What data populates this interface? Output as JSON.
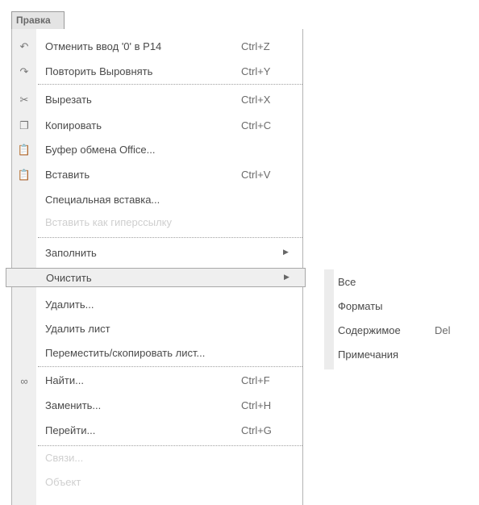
{
  "menu": {
    "title": "Правка",
    "items": [
      {
        "label": "Отменить ввод '0' в P14",
        "shortcut": "Ctrl+Z",
        "icon": "undo-icon"
      },
      {
        "label": "Повторить Выровнять",
        "shortcut": "Ctrl+Y",
        "icon": "redo-icon"
      },
      {
        "label": "Вырезать",
        "shortcut": "Ctrl+X",
        "icon": "scissors-icon"
      },
      {
        "label": "Копировать",
        "shortcut": "Ctrl+C",
        "icon": "copy-icon"
      },
      {
        "label": "Буфер обмена Office...",
        "shortcut": "",
        "icon": "clipboard-icon"
      },
      {
        "label": "Вставить",
        "shortcut": "Ctrl+V",
        "icon": "paste-icon"
      },
      {
        "label": "Специальная вставка...",
        "shortcut": ""
      },
      {
        "label": "Вставить как гиперссылку",
        "shortcut": "",
        "disabled": true
      },
      {
        "label": "Заполнить",
        "shortcut": "",
        "submenu": true
      },
      {
        "label": "Очистить",
        "shortcut": "",
        "submenu": true,
        "highlighted": true
      },
      {
        "label": "Удалить...",
        "shortcut": ""
      },
      {
        "label": "Удалить лист",
        "shortcut": ""
      },
      {
        "label": "Переместить/скопировать лист...",
        "shortcut": ""
      },
      {
        "label": "Найти...",
        "shortcut": "Ctrl+F",
        "icon": "binoculars-icon"
      },
      {
        "label": "Заменить...",
        "shortcut": "Ctrl+H"
      },
      {
        "label": "Перейти...",
        "shortcut": "Ctrl+G"
      },
      {
        "label": "Связи...",
        "shortcut": "",
        "disabled": true
      },
      {
        "label": "Объект",
        "shortcut": "",
        "disabled": true
      }
    ]
  },
  "submenu": {
    "items": [
      {
        "label": "Все",
        "shortcut": ""
      },
      {
        "label": "Форматы",
        "shortcut": ""
      },
      {
        "label": "Содержимое",
        "shortcut": "Del"
      },
      {
        "label": "Примечания",
        "shortcut": ""
      }
    ]
  }
}
